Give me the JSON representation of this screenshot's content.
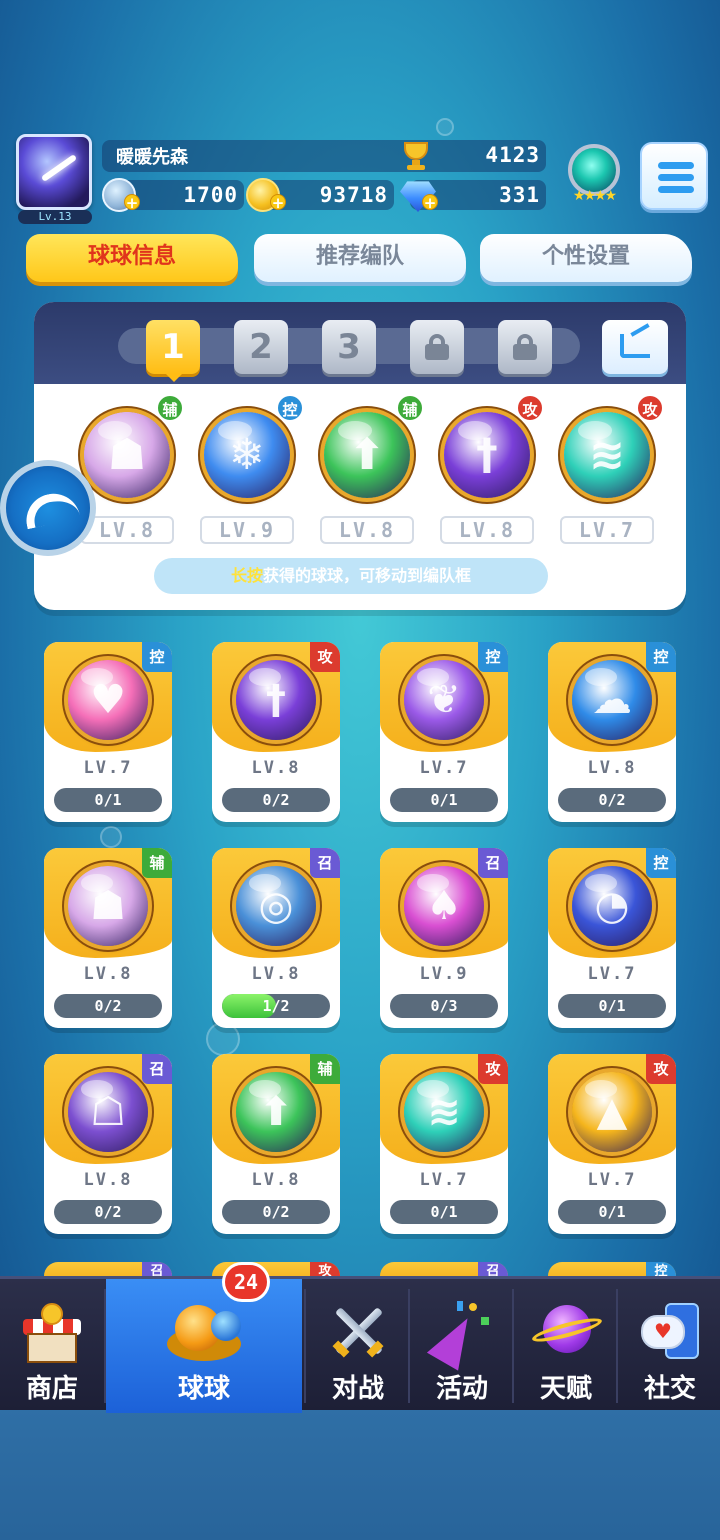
{
  "player": {
    "name": "暖暖先森",
    "level_badge": "Lv.13",
    "trophies": "4123",
    "energy": "1700",
    "coins": "93718",
    "gems": "331",
    "rank_stars": "★★★★"
  },
  "tabs": [
    {
      "label": "球球信息",
      "active": true
    },
    {
      "label": "推荐编队",
      "active": false
    },
    {
      "label": "个性设置",
      "active": false
    }
  ],
  "team": {
    "slots": [
      {
        "label": "1",
        "active": true,
        "locked": false
      },
      {
        "label": "2",
        "active": false,
        "locked": false
      },
      {
        "label": "3",
        "active": false,
        "locked": false
      },
      {
        "label": "",
        "active": false,
        "locked": true
      },
      {
        "label": "",
        "active": false,
        "locked": true
      }
    ],
    "members": [
      {
        "role": "辅",
        "level": "LV.8",
        "color": "#d7a8e8",
        "glyph": "silhouette"
      },
      {
        "role": "控",
        "level": "LV.9",
        "color": "#3f8cf0",
        "glyph": "snowflake"
      },
      {
        "role": "辅",
        "level": "LV.8",
        "color": "#3cc45a",
        "glyph": "star-arrow"
      },
      {
        "role": "攻",
        "level": "LV.8",
        "color": "#7a3fd8",
        "glyph": "sword"
      },
      {
        "role": "攻",
        "level": "LV.7",
        "color": "#2ed0b8",
        "glyph": "tornado"
      }
    ],
    "hint_highlight": "长按",
    "hint_text": "获得的球球，可移动到编队框"
  },
  "collection": [
    {
      "role": "控",
      "level": "LV.7",
      "progress": "0/1",
      "fill": 0,
      "color": "#f56fb8",
      "glyph": "heart"
    },
    {
      "role": "攻",
      "level": "LV.8",
      "progress": "0/2",
      "fill": 0,
      "color": "#7a3fd8",
      "glyph": "sword"
    },
    {
      "role": "控",
      "level": "LV.7",
      "progress": "0/1",
      "fill": 0,
      "color": "#9b5ae8",
      "glyph": "butterfly"
    },
    {
      "role": "控",
      "level": "LV.8",
      "progress": "0/2",
      "fill": 0,
      "color": "#2f8be8",
      "glyph": "cloud"
    },
    {
      "role": "辅",
      "level": "LV.8",
      "progress": "0/2",
      "fill": 0,
      "color": "#d7a8e8",
      "glyph": "silhouette"
    },
    {
      "role": "召",
      "level": "LV.8",
      "progress": "1/2",
      "fill": 0.5,
      "color": "#4a90d8",
      "glyph": "vortex"
    },
    {
      "role": "召",
      "level": "LV.9",
      "progress": "0/3",
      "fill": 0,
      "color": "#d94fd2",
      "glyph": "mushroom"
    },
    {
      "role": "控",
      "level": "LV.7",
      "progress": "0/1",
      "fill": 0,
      "color": "#3a55d8",
      "glyph": "clock"
    },
    {
      "role": "召",
      "level": "LV.8",
      "progress": "0/2",
      "fill": 0,
      "color": "#7c4fd0",
      "glyph": "ghost"
    },
    {
      "role": "辅",
      "level": "LV.8",
      "progress": "0/2",
      "fill": 0,
      "color": "#3cc45a",
      "glyph": "star-arrow"
    },
    {
      "role": "攻",
      "level": "LV.7",
      "progress": "0/1",
      "fill": 0,
      "color": "#2ed0b8",
      "glyph": "tornado"
    },
    {
      "role": "攻",
      "level": "LV.7",
      "progress": "0/1",
      "fill": 0,
      "color": "#f5b51c",
      "glyph": "triangle"
    }
  ],
  "peek_roles": [
    "召",
    "攻",
    "召",
    "控"
  ],
  "nav": [
    {
      "label": "商店",
      "icon": "shop-icon",
      "active": false
    },
    {
      "label": "球球",
      "icon": "ball-icon",
      "active": true,
      "badge": "24"
    },
    {
      "label": "对战",
      "icon": "swords-icon",
      "active": false
    },
    {
      "label": "活动",
      "icon": "party-icon",
      "active": false
    },
    {
      "label": "天赋",
      "icon": "planet-icon",
      "active": false
    },
    {
      "label": "社交",
      "icon": "chat-icon",
      "active": false
    }
  ]
}
